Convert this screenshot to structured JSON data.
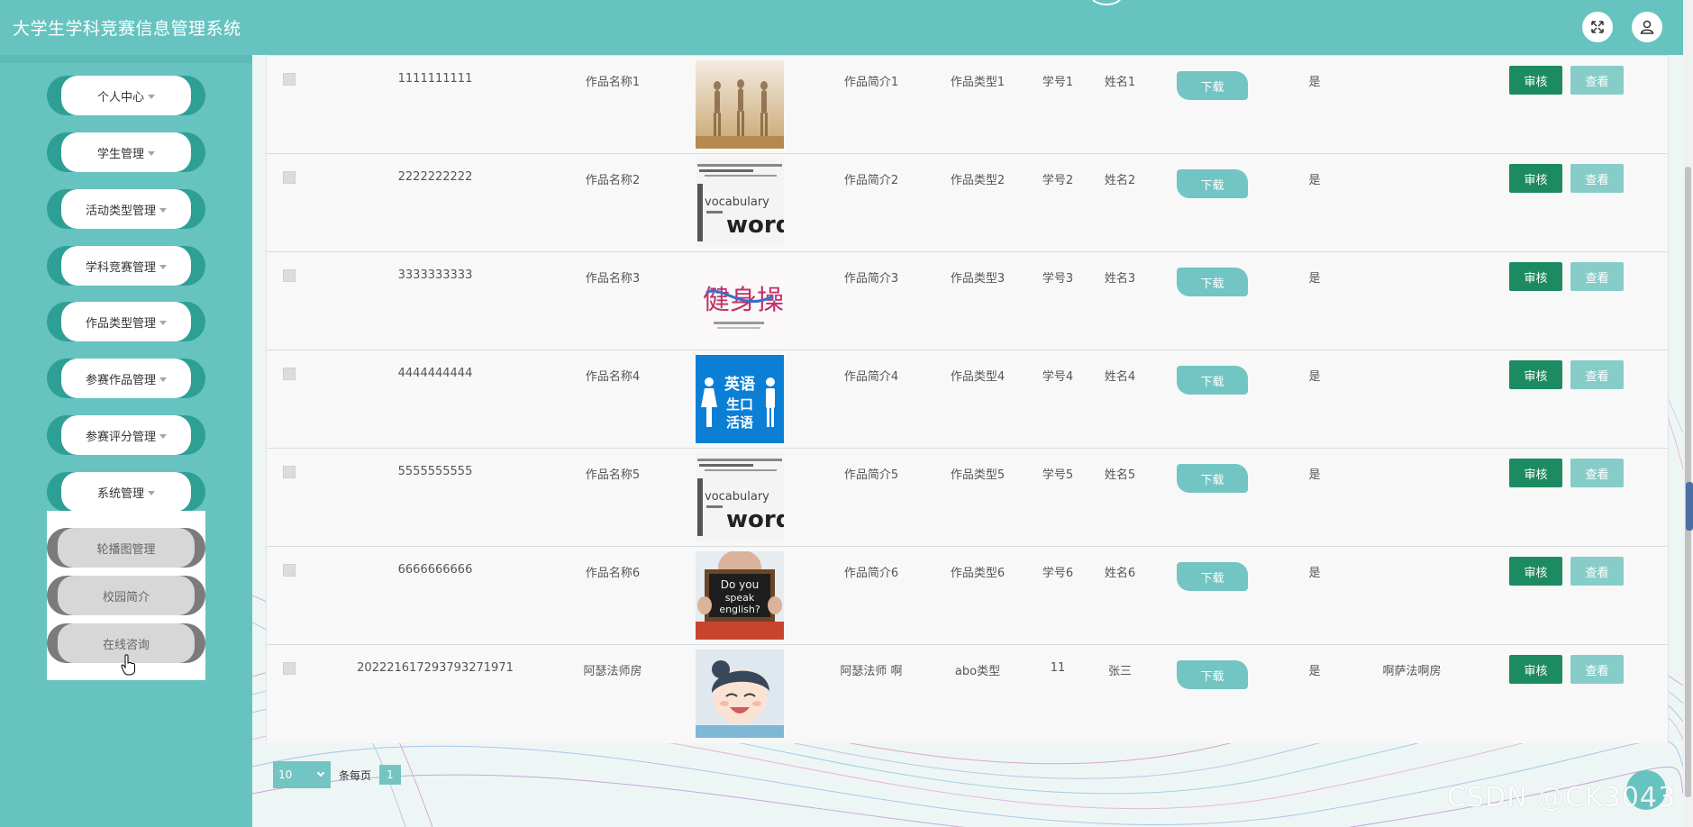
{
  "app": {
    "title": "大学生学科竞赛信息管理系统"
  },
  "sidebar": {
    "items": [
      {
        "label": "个人中心"
      },
      {
        "label": "学生管理"
      },
      {
        "label": "活动类型管理"
      },
      {
        "label": "学科竞赛管理"
      },
      {
        "label": "作品类型管理"
      },
      {
        "label": "参赛作品管理"
      },
      {
        "label": "参赛评分管理"
      },
      {
        "label": "系统管理"
      }
    ],
    "submenu": [
      {
        "label": "轮播图管理"
      },
      {
        "label": "校园简介"
      },
      {
        "label": "在线咨询"
      }
    ]
  },
  "table": {
    "download_label": "下载",
    "review_label": "审核",
    "view_label": "查看",
    "rows": [
      {
        "id": "1111111111",
        "name": "作品名称1",
        "intro": "作品简介1",
        "type": "作品类型1",
        "student_no": "学号1",
        "student_name": "姓名1",
        "flag": "是",
        "remark": "",
        "thumb": "dance"
      },
      {
        "id": "2222222222",
        "name": "作品名称2",
        "intro": "作品简介2",
        "type": "作品类型2",
        "student_no": "学号2",
        "student_name": "姓名2",
        "flag": "是",
        "remark": "",
        "thumb": "words"
      },
      {
        "id": "3333333333",
        "name": "作品名称3",
        "intro": "作品简介3",
        "type": "作品类型3",
        "student_no": "学号3",
        "student_name": "姓名3",
        "flag": "是",
        "remark": "",
        "thumb": "calligraphy"
      },
      {
        "id": "4444444444",
        "name": "作品名称4",
        "intro": "作品简介4",
        "type": "作品类型4",
        "student_no": "学号4",
        "student_name": "姓名4",
        "flag": "是",
        "remark": "",
        "thumb": "english-blue"
      },
      {
        "id": "5555555555",
        "name": "作品名称5",
        "intro": "作品简介5",
        "type": "作品类型5",
        "student_no": "学号5",
        "student_name": "姓名5",
        "flag": "是",
        "remark": "",
        "thumb": "words"
      },
      {
        "id": "6666666666",
        "name": "作品名称6",
        "intro": "作品简介6",
        "type": "作品类型6",
        "student_no": "学号6",
        "student_name": "姓名6",
        "flag": "是",
        "remark": "",
        "thumb": "chalkboard"
      },
      {
        "id": "202221617293793271971",
        "name": "阿瑟法师房",
        "intro": "阿瑟法师 啊",
        "type": "abo类型",
        "student_no": "11",
        "student_name": "张三",
        "flag": "是",
        "remark": "啊萨法啊房",
        "thumb": "anime"
      }
    ],
    "thumb_text": {
      "blue_line1": "英语",
      "blue_line2": "生口",
      "blue_line3": "活语",
      "chalk_line1": "Do you",
      "chalk_line2": "speak",
      "chalk_line3": "english?",
      "words_big": "words",
      "words_small": "vocabulary",
      "calli": "健身操"
    }
  },
  "pagination": {
    "page_size": "10",
    "per_page_label": "条每页",
    "current_page": "1"
  },
  "watermark": "CSDN @CK3043",
  "colors": {
    "header": "#66c3c0",
    "review_button": "#1d8b62",
    "view_button": "#86cdc9",
    "download_button": "#72c5c2"
  },
  "icons": {
    "fullscreen": "expand-icon",
    "user": "user-icon"
  }
}
